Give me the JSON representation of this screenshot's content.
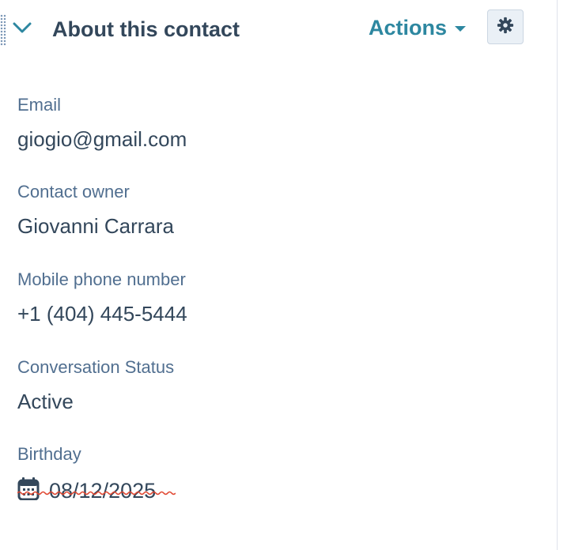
{
  "header": {
    "title": "About this contact",
    "actions_label": "Actions"
  },
  "fields": {
    "email": {
      "label": "Email",
      "value": "giogio@gmail.com"
    },
    "owner": {
      "label": "Contact owner",
      "value": "Giovanni Carrara"
    },
    "phone": {
      "label": "Mobile phone number",
      "value": "+1 (404) 445-5444"
    },
    "status": {
      "label": "Conversation Status",
      "value": "Active"
    },
    "birthday": {
      "label": "Birthday",
      "value": "08/12/2025"
    }
  },
  "colors": {
    "accent": "#2d87a0",
    "label": "#516f90",
    "value": "#33475b",
    "spellcheck": "#e0452f"
  },
  "icons": {
    "drag_handle": "drag-handle-icon",
    "collapse": "chevron-down-icon",
    "settings": "gear-icon",
    "calendar": "calendar-icon"
  }
}
